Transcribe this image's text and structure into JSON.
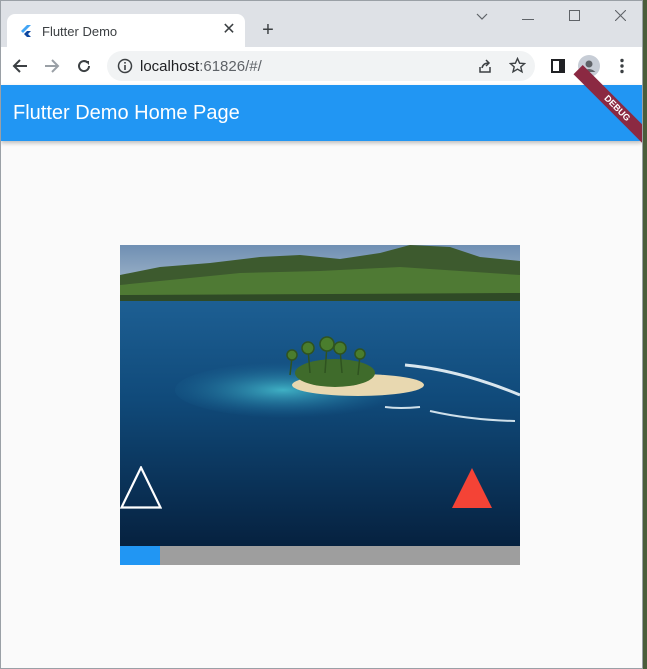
{
  "browser": {
    "tab": {
      "title": "Flutter Demo",
      "favicon": "flutter-logo-icon",
      "close_icon": "close-icon"
    },
    "new_tab_icon": "plus-icon",
    "window_controls": [
      "chevron-down-icon",
      "minimize-icon",
      "maximize-icon",
      "close-icon"
    ],
    "address": {
      "host": "localhost",
      "rest": ":61826/#/"
    },
    "nav_icons": [
      "back-arrow-icon",
      "forward-arrow-icon",
      "reload-icon",
      "info-icon"
    ],
    "toolbar_icons": [
      "share-icon",
      "star-icon",
      "side-panel-icon",
      "profile-icon",
      "more-vert-icon"
    ]
  },
  "app": {
    "title": "Flutter Demo Home Page",
    "debug_banner": "DEBUG",
    "primary_color": "#2196f3",
    "video": {
      "progress": 0.1,
      "left_control": "outline-triangle-icon",
      "right_control": "red-triangle-icon",
      "accent_red": "#f44336"
    }
  }
}
